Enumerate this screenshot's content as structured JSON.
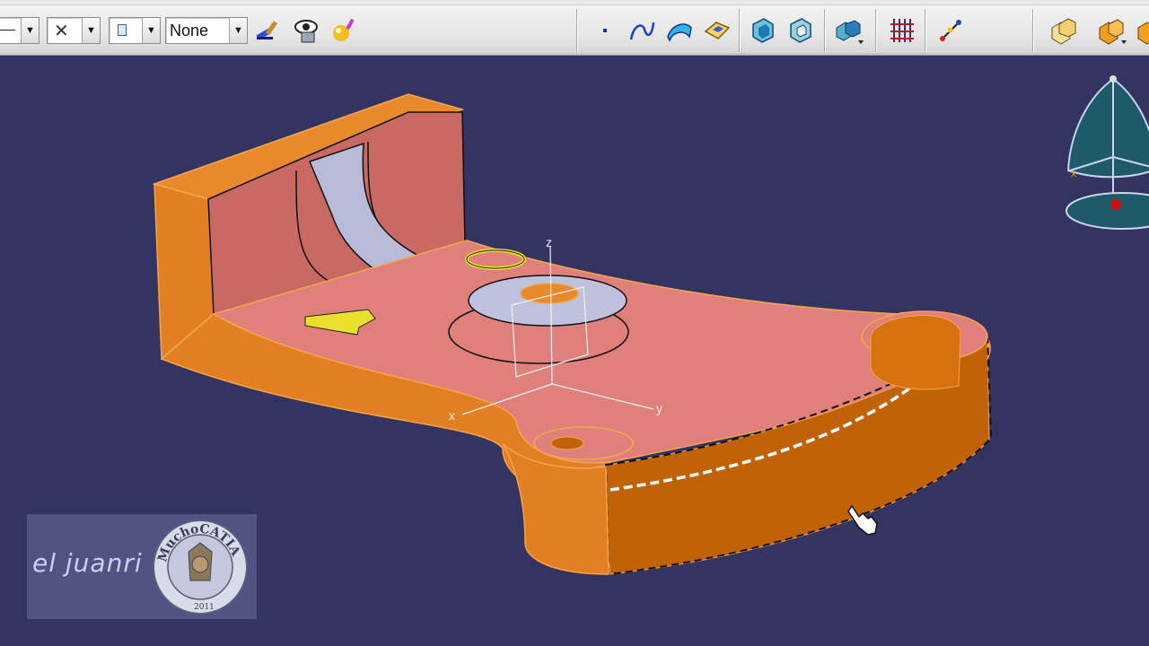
{
  "toolbar": {
    "line_type_combo": {
      "value": ""
    },
    "line_weight_combo": {
      "value": ""
    },
    "layer_combo": {
      "value": ""
    },
    "layer_filter_combo": {
      "value": "None"
    },
    "tools": [
      {
        "name": "painter-icon"
      },
      {
        "name": "hide-show-icon"
      },
      {
        "name": "properties-icon"
      },
      {
        "name": "point-icon"
      },
      {
        "name": "curve-icon"
      },
      {
        "name": "surface-icon"
      },
      {
        "name": "volume-icon"
      },
      {
        "name": "pad-icon"
      },
      {
        "name": "pocket-icon"
      },
      {
        "name": "boolean-icon"
      },
      {
        "name": "analysis-grid-icon"
      },
      {
        "name": "measure-icon"
      },
      {
        "name": "product-icon"
      },
      {
        "name": "part-body-icon"
      }
    ]
  },
  "viewport": {
    "background_color": "#343463",
    "part_color": "#e07f27",
    "face_color": "#e08080",
    "axis_labels": {
      "x": "x",
      "y": "y",
      "z": "z"
    },
    "compass_axis_label": "x"
  },
  "watermark": {
    "text": "el juanri",
    "logo_text": "MuchoCATIA",
    "logo_year": "2011"
  }
}
